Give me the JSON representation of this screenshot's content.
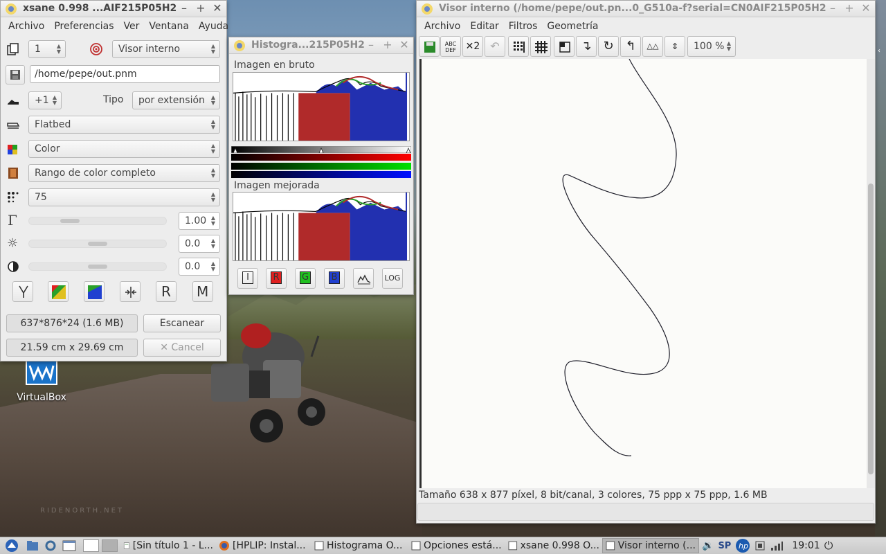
{
  "xsane": {
    "title": "xsane 0.998 ...AIF215P05H2",
    "menu": [
      "Archivo",
      "Preferencias",
      "Ver",
      "Ventana",
      "Ayuda"
    ],
    "copies": "1",
    "target": "Visor interno",
    "filename": "/home/pepe/out.pnm",
    "increment": "+1",
    "tipo_label": "Tipo",
    "tipo_value": "por extensión",
    "source": "Flatbed",
    "color_mode": "Color",
    "color_range": "Rango de color completo",
    "resolution": "75",
    "gamma": "1.00",
    "brightness": "0.0",
    "contrast": "0.0",
    "size_info": "637*876*24 (1.6 MB)",
    "scan_button": "Escanear",
    "dimensions": "21.59 cm x 29.69 cm",
    "cancel_button": "Cancel"
  },
  "histogram": {
    "title": "Histogra...215P05H2",
    "raw_label": "Imagen en bruto",
    "enhanced_label": "Imagen mejorada",
    "buttons": [
      "I",
      "R",
      "G",
      "B",
      "LOG"
    ]
  },
  "viewer": {
    "title": "Visor interno (/home/pepe/out.pn...0_G510a-f?serial=CN0AIF215P05H2",
    "menu": [
      "Archivo",
      "Editar",
      "Filtros",
      "Geometría"
    ],
    "zoom": "100 %",
    "status": "Tamaño 638 x 877 píxel, 8 bit/canal, 3 colores, 75 ppp x 75 ppp, 1.6 MB"
  },
  "desktop": {
    "icon_label": "VirtualBox",
    "watermark": "RIDENORTH.NET"
  },
  "taskbar": {
    "items": [
      "[Sin título 1 - L...",
      "[HPLIP: Instal...",
      "Histograma O...",
      "Opciones está...",
      "xsane 0.998 O...",
      "Visor interno (..."
    ],
    "lang": "SP",
    "clock": "19:01"
  },
  "colors": {
    "histo_red": "#b02a2a",
    "histo_green": "#2aa02a",
    "histo_blue": "#2230b0"
  }
}
